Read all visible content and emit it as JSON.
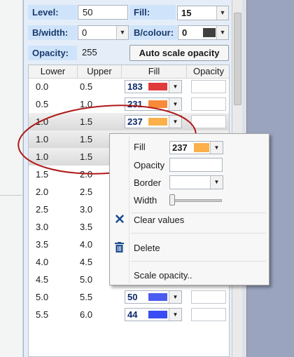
{
  "controls": {
    "level_label": "Level:",
    "level_value": "50",
    "fill_label": "Fill:",
    "fill_value": "15",
    "bwidth_label": "B/width:",
    "bwidth_value": "0",
    "bcolour_label": "B/colour:",
    "bcolour_value": "0",
    "bcolour_color": "#404040",
    "opacity_label": "Opacity:",
    "opacity_value": "255",
    "auto_scale_label": "Auto scale opacity"
  },
  "table": {
    "columns": [
      "Lower",
      "Upper",
      "Fill",
      "Opacity"
    ],
    "rows": [
      {
        "lower": "0.0",
        "upper": "0.5",
        "fill": "183",
        "color": "#e03a3a"
      },
      {
        "lower": "0.5",
        "upper": "1.0",
        "fill": "231",
        "color": "#f88a3a"
      },
      {
        "lower": "1.0",
        "upper": "1.5",
        "fill": "237",
        "color": "#fbb04a"
      },
      {
        "lower": "1.0",
        "upper": "1.5",
        "fill": "",
        "color": ""
      },
      {
        "lower": "1.0",
        "upper": "1.5",
        "fill": "",
        "color": ""
      },
      {
        "lower": "1.5",
        "upper": "2.0",
        "fill": "",
        "color": ""
      },
      {
        "lower": "2.0",
        "upper": "2.5",
        "fill": "",
        "color": ""
      },
      {
        "lower": "2.5",
        "upper": "3.0",
        "fill": "",
        "color": ""
      },
      {
        "lower": "3.0",
        "upper": "3.5",
        "fill": "",
        "color": ""
      },
      {
        "lower": "3.5",
        "upper": "4.0",
        "fill": "",
        "color": ""
      },
      {
        "lower": "4.0",
        "upper": "4.5",
        "fill": "",
        "color": ""
      },
      {
        "lower": "4.5",
        "upper": "5.0",
        "fill": "",
        "color": ""
      },
      {
        "lower": "5.0",
        "upper": "5.5",
        "fill": "50",
        "color": "#4a5cf0"
      },
      {
        "lower": "5.5",
        "upper": "6.0",
        "fill": "44",
        "color": "#3a4cf4"
      }
    ]
  },
  "context_menu": {
    "fill_label": "Fill",
    "fill_value": "237",
    "fill_color": "#fbb04a",
    "opacity_label": "Opacity",
    "border_label": "Border",
    "width_label": "Width",
    "clear_label": "Clear values",
    "delete_label": "Delete",
    "scale_label": "Scale opacity..",
    "clear_icon": "x-icon",
    "delete_icon": "trash-icon"
  },
  "colors": {
    "highlight_ellipse": "#b01818",
    "label_bg": "#cfe4fb"
  }
}
